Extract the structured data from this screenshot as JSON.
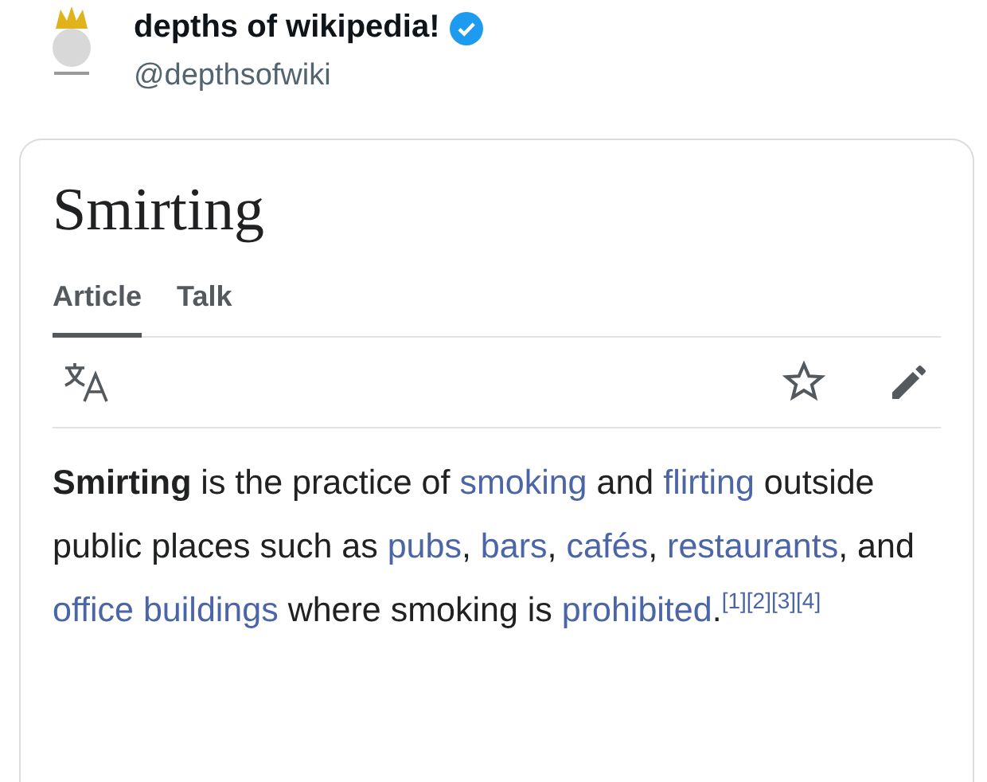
{
  "post": {
    "display_name": "depths of wikipedia!",
    "verified": true,
    "handle": "@depthsofwiki"
  },
  "article": {
    "title": "Smirting",
    "tabs": [
      {
        "label": "Article",
        "selected": true
      },
      {
        "label": "Talk",
        "selected": false
      }
    ],
    "paragraph": [
      {
        "kind": "bold",
        "text": "Smirting"
      },
      {
        "kind": "plain",
        "text": " is the practice of "
      },
      {
        "kind": "link",
        "text": "smoking"
      },
      {
        "kind": "plain",
        "text": " and "
      },
      {
        "kind": "link",
        "text": "flirting"
      },
      {
        "kind": "plain",
        "text": " outside public places such as "
      },
      {
        "kind": "link",
        "text": "pubs"
      },
      {
        "kind": "plain",
        "text": ", "
      },
      {
        "kind": "link",
        "text": "bars"
      },
      {
        "kind": "plain",
        "text": ", "
      },
      {
        "kind": "link",
        "text": "cafés"
      },
      {
        "kind": "plain",
        "text": ", "
      },
      {
        "kind": "link",
        "text": "restaurants"
      },
      {
        "kind": "plain",
        "text": ", and "
      },
      {
        "kind": "link",
        "text": "office buildings"
      },
      {
        "kind": "plain",
        "text": " where smoking is "
      },
      {
        "kind": "link",
        "text": "prohibited"
      },
      {
        "kind": "plain",
        "text": "."
      },
      {
        "kind": "ref",
        "text": "[1]"
      },
      {
        "kind": "ref",
        "text": "[2]"
      },
      {
        "kind": "ref",
        "text": "[3]"
      },
      {
        "kind": "ref",
        "text": "[4]"
      }
    ]
  }
}
